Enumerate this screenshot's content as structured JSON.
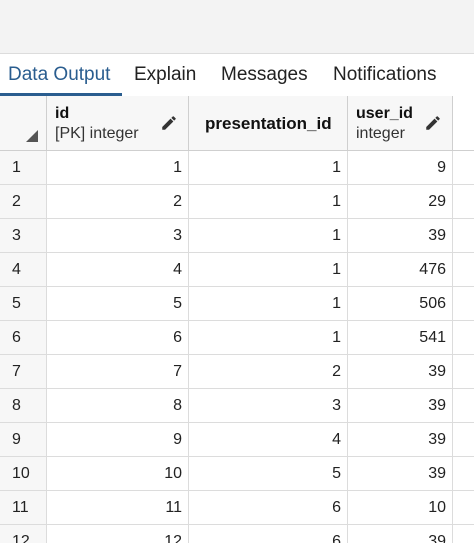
{
  "tabs": [
    {
      "label": "Data Output",
      "active": true
    },
    {
      "label": "Explain",
      "active": false
    },
    {
      "label": "Messages",
      "active": false
    },
    {
      "label": "Notifications",
      "active": false
    }
  ],
  "columns": [
    {
      "name": "id",
      "type": "[PK] integer"
    },
    {
      "name": "presentation_id",
      "type": ""
    },
    {
      "name": "user_id",
      "type": "integer"
    }
  ],
  "rows": [
    {
      "n": "1",
      "id": "1",
      "presentation_id": "1",
      "user_id": "9"
    },
    {
      "n": "2",
      "id": "2",
      "presentation_id": "1",
      "user_id": "29"
    },
    {
      "n": "3",
      "id": "3",
      "presentation_id": "1",
      "user_id": "39"
    },
    {
      "n": "4",
      "id": "4",
      "presentation_id": "1",
      "user_id": "476"
    },
    {
      "n": "5",
      "id": "5",
      "presentation_id": "1",
      "user_id": "506"
    },
    {
      "n": "6",
      "id": "6",
      "presentation_id": "1",
      "user_id": "541"
    },
    {
      "n": "7",
      "id": "7",
      "presentation_id": "2",
      "user_id": "39"
    },
    {
      "n": "8",
      "id": "8",
      "presentation_id": "3",
      "user_id": "39"
    },
    {
      "n": "9",
      "id": "9",
      "presentation_id": "4",
      "user_id": "39"
    },
    {
      "n": "10",
      "id": "10",
      "presentation_id": "5",
      "user_id": "39"
    },
    {
      "n": "11",
      "id": "11",
      "presentation_id": "6",
      "user_id": "10"
    },
    {
      "n": "12",
      "id": "12",
      "presentation_id": "6",
      "user_id": "39"
    }
  ],
  "colors": {
    "accent": "#2a5d8f"
  },
  "icons": {
    "edit": "pencil-icon",
    "sort": "sort-corner-icon"
  }
}
